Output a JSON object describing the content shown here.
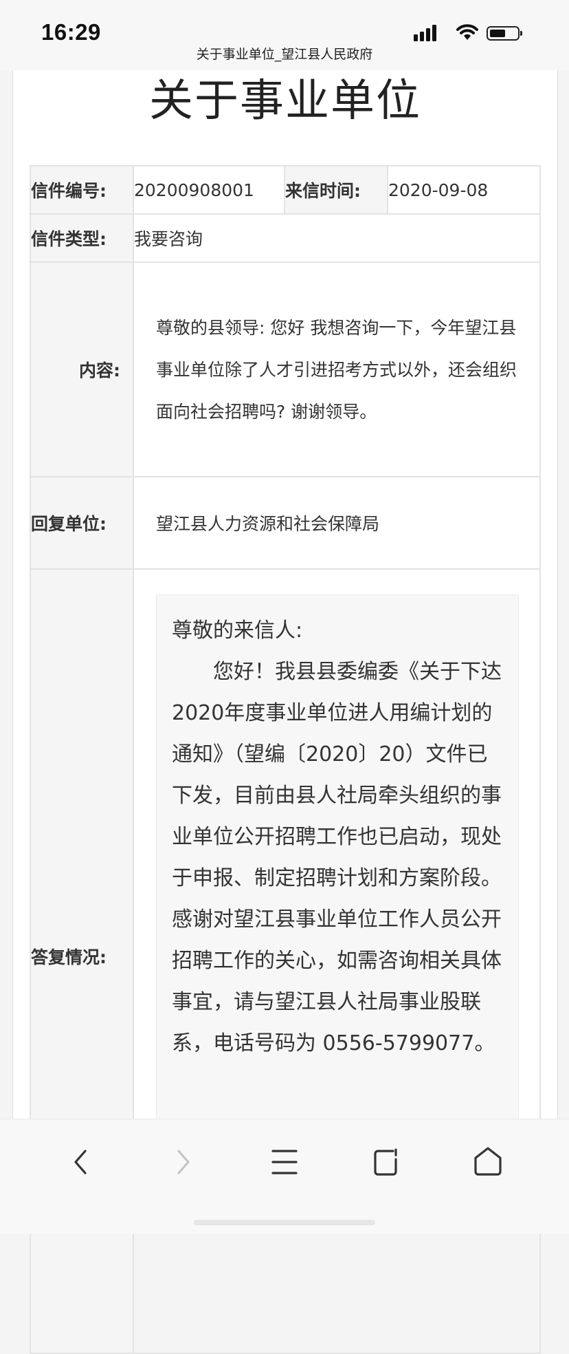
{
  "status_bar": {
    "time": "16:29",
    "page_title": "关于事业单位_望江县人民政府",
    "icons": [
      "signal-icon",
      "wifi-icon",
      "battery-icon"
    ]
  },
  "letter": {
    "title": "关于事业单位",
    "number_label": "信件编号:",
    "number": "20200908001",
    "date_label": "来信时间:",
    "date": "2020-09-08",
    "type_label": "信件类型:",
    "type": "我要咨询",
    "content_label": "内容:",
    "content": "尊敬的县领导: 您好 我想咨询一下，今年望江县事业单位除了人才引进招考方式以外，还会组织面向社会招聘吗? 谢谢领导。",
    "reply_unit_label": "回复单位:",
    "reply_unit": "望江县人力资源和社会保障局",
    "reply_label": "答复情况:",
    "reply_greeting": "尊敬的来信人:",
    "reply_body": "您好！我县县委编委《关于下达2020年度事业单位进人用编计划的通知》（望编〔2020〕20）文件已下发，目前由县人社局牵头组织的事业单位公开招聘工作也已启动，现处于申报、制定招聘计划和方案阶段。感谢对望江县事业单位工作人员公开招聘工作的关心，如需咨询相关具体事宜，请与望江县人社局事业股联系，电话号码为 0556-5799077。"
  },
  "bottom_nav": {
    "icons": [
      "back-arrow-icon",
      "forward-arrow-icon",
      "menu-icon",
      "tabs-icon",
      "home-icon"
    ]
  }
}
